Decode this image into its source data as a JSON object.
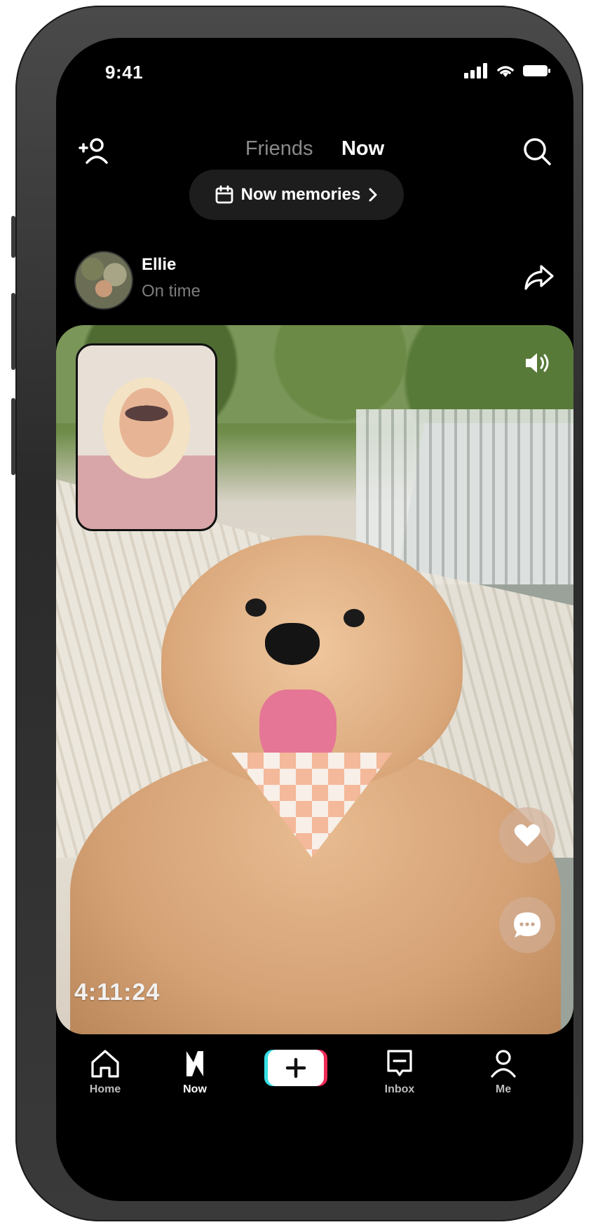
{
  "status_bar": {
    "time": "9:41"
  },
  "top_bar": {
    "tabs": [
      {
        "label": "Friends",
        "active": false
      },
      {
        "label": "Now",
        "active": true
      }
    ]
  },
  "memories_button": {
    "label": "Now memories"
  },
  "post": {
    "user_name": "Ellie",
    "status": "On time",
    "timestamp": "4:11:24"
  },
  "bottom_nav": {
    "items": [
      {
        "label": "Home",
        "icon": "home-icon",
        "active": false
      },
      {
        "label": "Now",
        "icon": "now-bolt-icon",
        "active": true
      },
      {
        "label": "",
        "icon": "plus-icon",
        "active": false
      },
      {
        "label": "Inbox",
        "icon": "inbox-icon",
        "active": false
      },
      {
        "label": "Me",
        "icon": "profile-icon",
        "active": false
      }
    ]
  },
  "colors": {
    "background": "#000000",
    "pill": "#1d1d1d",
    "inactive_tab": "#8a8a8a",
    "create_cyan": "#37dfe3",
    "create_red": "#ee2a58"
  }
}
